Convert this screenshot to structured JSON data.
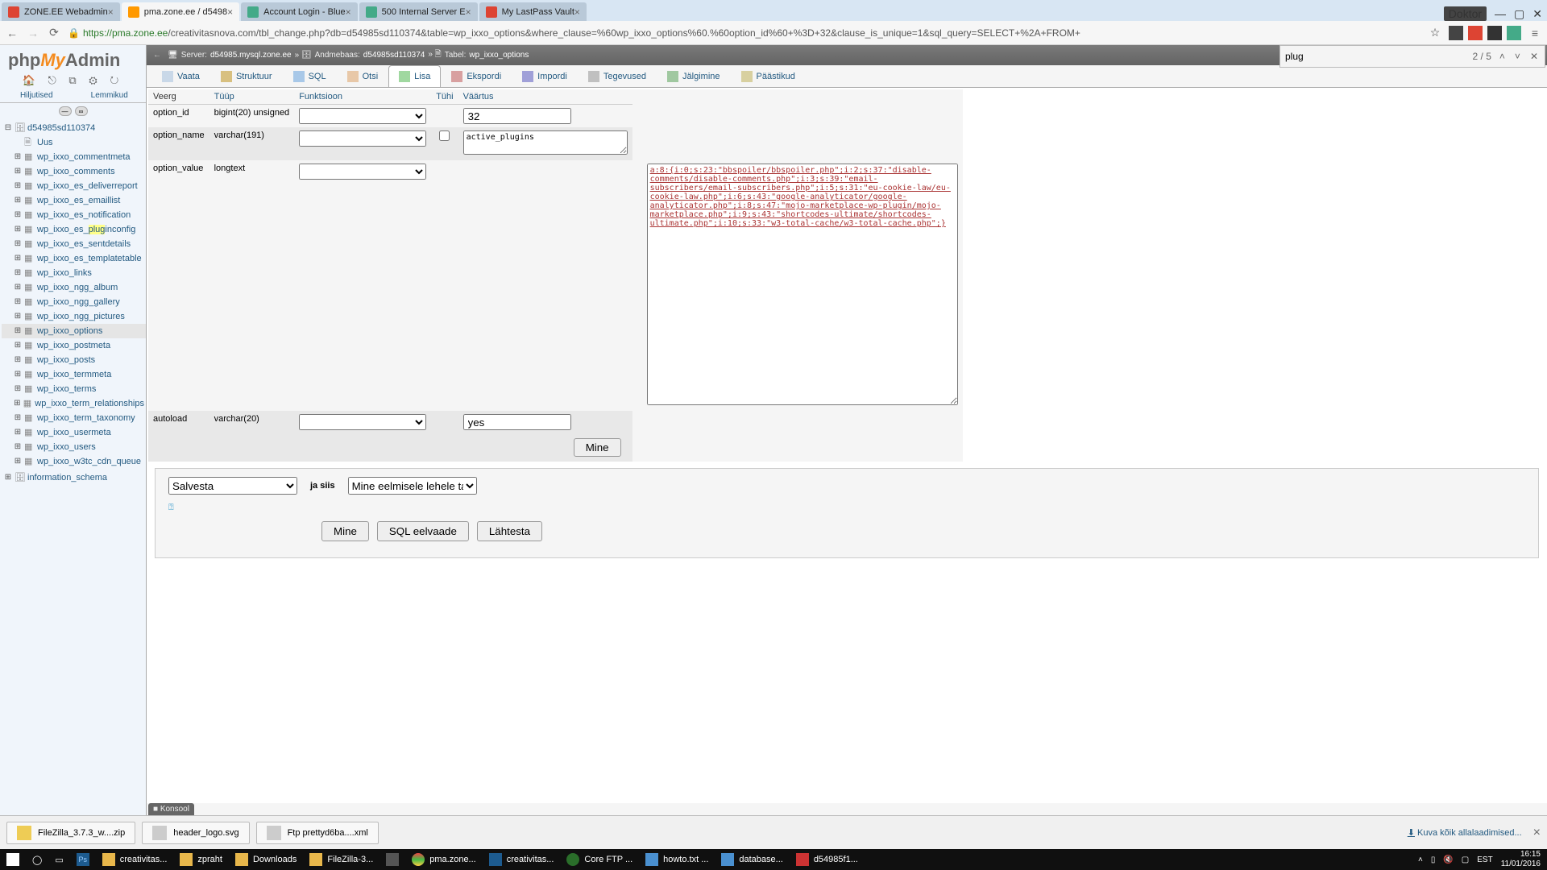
{
  "browser": {
    "tabs": [
      {
        "title": "ZONE.EE Webadmin"
      },
      {
        "title": "pma.zone.ee / d5498"
      },
      {
        "title": "Account Login - Blue"
      },
      {
        "title": "500 Internal Server E"
      },
      {
        "title": "My LastPass Vault"
      }
    ],
    "avatar": "Doktor",
    "url_host": "https://pma.zone.ee",
    "url_path": "/creativitasnova.com/tbl_change.php?db=d54985sd110374&table=wp_ixxo_options&where_clause=%60wp_ixxo_options%60.%60option_id%60+%3D+32&clause_is_unique=1&sql_query=SELECT+%2A+FROM+"
  },
  "find": {
    "query": "plug",
    "count": "2 / 5"
  },
  "sidebar": {
    "brand": [
      "php",
      "My",
      "Admin"
    ],
    "tabs": [
      "Hiljutised",
      "Lemmikud"
    ],
    "db": "d54985sd110374",
    "uus": "Uus",
    "tables": [
      "wp_ixxo_commentmeta",
      "wp_ixxo_comments",
      "wp_ixxo_es_deliverreport",
      "wp_ixxo_es_emaillist",
      "wp_ixxo_es_notification",
      "wp_ixxo_es_pluginconfig",
      "wp_ixxo_es_sentdetails",
      "wp_ixxo_es_templatetable",
      "wp_ixxo_links",
      "wp_ixxo_ngg_album",
      "wp_ixxo_ngg_gallery",
      "wp_ixxo_ngg_pictures",
      "wp_ixxo_options",
      "wp_ixxo_postmeta",
      "wp_ixxo_posts",
      "wp_ixxo_termmeta",
      "wp_ixxo_terms",
      "wp_ixxo_term_relationships",
      "wp_ixxo_term_taxonomy",
      "wp_ixxo_usermeta",
      "wp_ixxo_users",
      "wp_ixxo_w3tc_cdn_queue"
    ],
    "highlight_idx": 5,
    "highlight_pre": "wp_ixxo_es_",
    "highlight_hl": "plug",
    "highlight_post": "inconfig",
    "selected_idx": 12,
    "info_schema": "information_schema"
  },
  "breadcrumb": {
    "server_label": "Server:",
    "server": "d54985.mysql.zone.ee",
    "db_label": "Andmebaas:",
    "db": "d54985sd110374",
    "table_label": "Tabel:",
    "table": "wp_ixxo_options"
  },
  "contenttabs": [
    {
      "label": "Vaata"
    },
    {
      "label": "Struktuur"
    },
    {
      "label": "SQL"
    },
    {
      "label": "Otsi"
    },
    {
      "label": "Lisa"
    },
    {
      "label": "Ekspordi"
    },
    {
      "label": "Impordi"
    },
    {
      "label": "Tegevused"
    },
    {
      "label": "Jälgimine"
    },
    {
      "label": "Päästikud"
    }
  ],
  "active_tab": 4,
  "grid": {
    "headers": [
      "Veerg",
      "Tüüp",
      "Funktsioon",
      "Tühi",
      "Väärtus"
    ],
    "rows": [
      {
        "col": "option_id",
        "type": "bigint(20) unsigned",
        "nullable": false,
        "value": "32",
        "widget": "input"
      },
      {
        "col": "option_name",
        "type": "varchar(191)",
        "nullable": true,
        "value": "active_plugins",
        "widget": "textarea_sm"
      },
      {
        "col": "option_value",
        "type": "longtext",
        "nullable": false,
        "value": "a:8:{i:0;s:23:\"bbspoiler/bbspoiler.php\";i:2;s:37:\"disable-comments/disable-comments.php\";i:3;s:39:\"email-subscribers/email-subscribers.php\";i:5;s:31:\"eu-cookie-law/eu-cookie-law.php\";i:6;s:43:\"google-analyticator/google-analyticator.php\";i:8;s:47:\"mojo-marketplace-wp-plugin/mojo-marketplace.php\";i:9;s:43:\"shortcodes-ultimate/shortcodes-ultimate.php\";i:10;s:33:\"w3-total-cache/w3-total-cache.php\";}",
        "widget": "textarea_lg"
      },
      {
        "col": "autoload",
        "type": "varchar(20)",
        "nullable": false,
        "value": "yes",
        "widget": "input"
      }
    ],
    "go": "Mine"
  },
  "savebox": {
    "save_opt": "Salvesta",
    "ja_siis": "ja siis",
    "then_opt": "Mine eelmisele lehele tagasi",
    "go": "Mine",
    "preview": "SQL eelvaade",
    "reset": "Lähtesta"
  },
  "console": "Konsool",
  "downloads": [
    {
      "name": "FileZilla_3.7.3_w....zip"
    },
    {
      "name": "header_logo.svg"
    },
    {
      "name": "Ftp prettyd6ba....xml"
    }
  ],
  "showall": "Kuva kõik allalaadimised...",
  "taskbar": {
    "items": [
      {
        "label": ""
      },
      {
        "label": ""
      },
      {
        "label": ""
      },
      {
        "label": ""
      },
      {
        "label": "creativitas..."
      },
      {
        "label": "zpraht"
      },
      {
        "label": "Downloads"
      },
      {
        "label": "FileZilla-3..."
      },
      {
        "label": ""
      },
      {
        "label": "pma.zone..."
      },
      {
        "label": "creativitas..."
      },
      {
        "label": "Core FTP ..."
      },
      {
        "label": "howto.txt ..."
      },
      {
        "label": "database..."
      },
      {
        "label": "d54985f1..."
      }
    ],
    "lang": "EST",
    "time": "16:15",
    "date": "11/01/2016"
  }
}
